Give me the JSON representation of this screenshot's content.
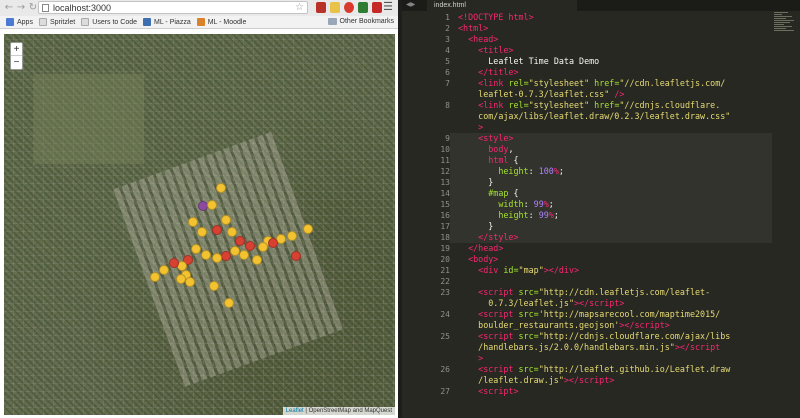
{
  "browser": {
    "url": "localhost:3000",
    "bookmarks": [
      {
        "label": "Apps",
        "color": "#4a7bd0"
      },
      {
        "label": "Spritzlet",
        "color": "#dcdcdc"
      },
      {
        "label": "Users to Code",
        "color": "#dcdcdc"
      },
      {
        "label": "ML - Piazza",
        "color": "#3e6fb0"
      },
      {
        "label": "ML - Moodle",
        "color": "#d9822b"
      }
    ],
    "other_bookmarks": "Other Bookmarks",
    "zoom_in": "+",
    "zoom_out": "−",
    "attribution": {
      "leaflet": "Leaflet",
      "rest": "| OpenStreetMap and MapQuest"
    },
    "marker_colors": {
      "yellow": "#f2c230",
      "red": "#d64132",
      "purple": "#8b4a9e"
    }
  },
  "editor": {
    "tab_label": "index.html",
    "lines": [
      {
        "n": "1",
        "html": "<span class=\"t\">&lt;!DOCTYPE html&gt;</span>"
      },
      {
        "n": "2",
        "html": "<span class=\"t\">&lt;html&gt;</span>"
      },
      {
        "n": "3",
        "html": "  <span class=\"t\">&lt;head&gt;</span>"
      },
      {
        "n": "4",
        "html": "    <span class=\"t\">&lt;title&gt;</span>"
      },
      {
        "n": "5",
        "html": "      <span class=\"w\">Leaflet Time Data Demo</span>"
      },
      {
        "n": "6",
        "html": "    <span class=\"t\">&lt;/title&gt;</span>"
      },
      {
        "n": "7",
        "html": "    <span class=\"t\">&lt;link</span> <span class=\"a\">rel=</span><span class=\"s\">\"stylesheet\"</span> <span class=\"a\">href=</span><span class=\"s\">\"//cdn.leafletjs.com/</span>"
      },
      {
        "n": "",
        "html": "    <span class=\"s\">leaflet-0.7.3/leaflet.css\"</span> <span class=\"t\">/&gt;</span>"
      },
      {
        "n": "8",
        "html": "    <span class=\"t\">&lt;link</span> <span class=\"a\">rel=</span><span class=\"s\">\"stylesheet\"</span> <span class=\"a\">href=</span><span class=\"s\">\"//cdnjs.cloudflare.</span>"
      },
      {
        "n": "",
        "html": "    <span class=\"s\">com/ajax/libs/leaflet.draw/0.2.3/leaflet.draw.css\"</span>"
      },
      {
        "n": "",
        "html": "    <span class=\"t\">&gt;</span>"
      },
      {
        "n": "9",
        "html": "    <span class=\"t\">&lt;style&gt;</span>"
      },
      {
        "n": "10",
        "html": "      <span class=\"t\">body</span>,"
      },
      {
        "n": "11",
        "html": "      <span class=\"t\">html</span> {"
      },
      {
        "n": "12",
        "html": "        <span class=\"a\">height</span>: <span class=\"n\">100</span><span class=\"t\">%</span>;"
      },
      {
        "n": "13",
        "html": "      }"
      },
      {
        "n": "14",
        "html": "      <span class=\"a\">#map</span> {"
      },
      {
        "n": "15",
        "html": "        <span class=\"a\">width</span>: <span class=\"n\">99</span><span class=\"t\">%</span>;"
      },
      {
        "n": "16",
        "html": "        <span class=\"a\">height</span>: <span class=\"n\">99</span><span class=\"t\">%</span>;"
      },
      {
        "n": "17",
        "html": "      }"
      },
      {
        "n": "18",
        "html": "    <span class=\"t\">&lt;/style&gt;</span>"
      },
      {
        "n": "19",
        "html": "  <span class=\"t\">&lt;/head&gt;</span>"
      },
      {
        "n": "20",
        "html": "  <span class=\"t\">&lt;body&gt;</span>"
      },
      {
        "n": "21",
        "html": "    <span class=\"t\">&lt;div</span> <span class=\"a\">id=</span><span class=\"s\">\"map\"</span><span class=\"t\">&gt;&lt;/div&gt;</span>"
      },
      {
        "n": "22",
        "html": ""
      },
      {
        "n": "23",
        "html": "    <span class=\"t\">&lt;script</span> <span class=\"a\">src=</span><span class=\"s\">\"http://cdn.leafletjs.com/leaflet-</span>"
      },
      {
        "n": "",
        "html": "      <span class=\"s\">0.7.3/leaflet.js\"</span><span class=\"t\">&gt;&lt;/script&gt;</span>"
      },
      {
        "n": "24",
        "html": "    <span class=\"t\">&lt;script</span> <span class=\"a\">src=</span><span class=\"s\">'http://mapsarecool.com/maptime2015/</span>"
      },
      {
        "n": "",
        "html": "    <span class=\"s\">boulder_restaurants.geojson'</span><span class=\"t\">&gt;&lt;/script&gt;</span>"
      },
      {
        "n": "25",
        "html": "    <span class=\"t\">&lt;script</span> <span class=\"a\">src=</span><span class=\"s\">\"http://cdnjs.cloudflare.com/ajax/libs</span>"
      },
      {
        "n": "",
        "html": "    <span class=\"s\">/handlebars.js/2.0.0/handlebars.min.js\"</span><span class=\"t\">&gt;&lt;/script</span>"
      },
      {
        "n": "",
        "html": "    <span class=\"t\">&gt;</span>"
      },
      {
        "n": "26",
        "html": "    <span class=\"t\">&lt;script</span> <span class=\"a\">src=</span><span class=\"s\">\"http://leaflet.github.io/Leaflet.draw</span>"
      },
      {
        "n": "",
        "html": "    <span class=\"s\">/leaflet.draw.js\"</span><span class=\"t\">&gt;&lt;/script&gt;</span>"
      },
      {
        "n": "27",
        "html": "    <span class=\"t\">&lt;script&gt;</span>"
      }
    ]
  }
}
